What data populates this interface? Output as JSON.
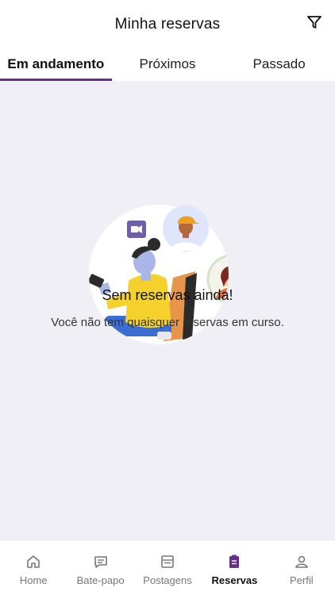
{
  "header": {
    "title": "Minha reservas",
    "filter_icon": "filter-icon"
  },
  "tabs": [
    {
      "label": "Em andamento",
      "active": true
    },
    {
      "label": "Próximos",
      "active": false
    },
    {
      "label": "Passado",
      "active": false
    }
  ],
  "empty_state": {
    "illustration": "video-call-illustration",
    "title": "Sem reservas ainda!",
    "description": "Você não tem quaisquer reservas em curso."
  },
  "bottom_nav": [
    {
      "label": "Home",
      "icon": "home-icon",
      "active": false
    },
    {
      "label": "Bate-papo",
      "icon": "chat-icon",
      "active": false
    },
    {
      "label": "Postagens",
      "icon": "posts-icon",
      "active": false
    },
    {
      "label": "Reservas",
      "icon": "bookings-icon",
      "active": true
    },
    {
      "label": "Perfil",
      "icon": "profile-icon",
      "active": false
    }
  ],
  "colors": {
    "accent": "#6a2c8a",
    "background": "#f1eff6",
    "surface": "#ffffff"
  }
}
